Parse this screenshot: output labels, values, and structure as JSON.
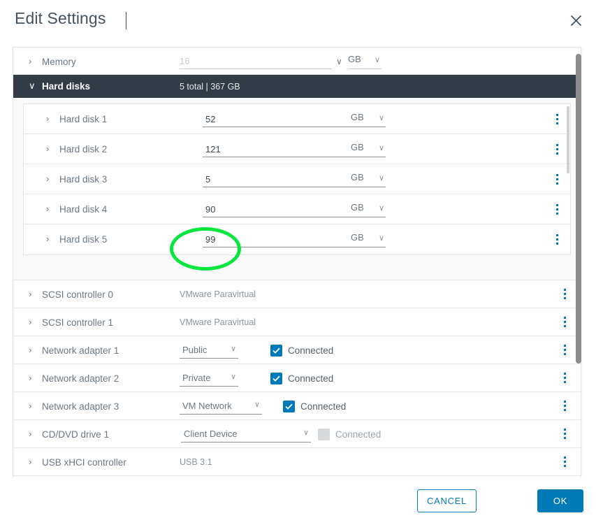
{
  "dialog": {
    "title": "Edit Settings",
    "close_icon": "close-icon"
  },
  "memory": {
    "label": "Memory",
    "caret": "›",
    "value": "",
    "placeholder": "16",
    "unit": "GB",
    "unit_chevron": "∨",
    "spinner_chevron": "∨"
  },
  "hard_disks_group": {
    "label": "Hard disks",
    "caret": "∨",
    "summary": "5 total | 367 GB",
    "disks": [
      {
        "label": "Hard disk 1",
        "caret": "›",
        "value": "52",
        "unit": "GB"
      },
      {
        "label": "Hard disk 2",
        "caret": "›",
        "value": "121",
        "unit": "GB"
      },
      {
        "label": "Hard disk 3",
        "caret": "›",
        "value": "5",
        "unit": "GB"
      },
      {
        "label": "Hard disk 4",
        "caret": "›",
        "value": "90",
        "unit": "GB"
      },
      {
        "label": "Hard disk 5",
        "caret": "›",
        "value": "99",
        "unit": "GB"
      }
    ]
  },
  "devices": [
    {
      "label": "SCSI controller 0",
      "caret": "›",
      "value": "VMware Paravirtual"
    },
    {
      "label": "SCSI controller 1",
      "caret": "›",
      "value": "VMware Paravirtual"
    },
    {
      "label": "Network adapter 1",
      "caret": "›",
      "dropdown": "Public",
      "checkbox_label": "Connected",
      "checked": true
    },
    {
      "label": "Network adapter 2",
      "caret": "›",
      "dropdown": "Private",
      "checkbox_label": "Connected",
      "checked": true
    },
    {
      "label": "Network adapter 3",
      "caret": "›",
      "dropdown": "VM Network",
      "checkbox_label": "Connected",
      "checked": true
    },
    {
      "label": "CD/DVD drive 1",
      "caret": "›",
      "dropdown": "Client Device",
      "checkbox_label": "Connected",
      "checked": false
    },
    {
      "label": "USB xHCI controller",
      "caret": "›",
      "value": "USB 3.1"
    }
  ],
  "footer": {
    "cancel_label": "CANCEL",
    "ok_label": "OK"
  },
  "annotation": {
    "shape": "ellipse",
    "color": "#07e63c",
    "targets": "hard-disk-5-size-input"
  },
  "colors": {
    "accent_blue": "#0079b8",
    "header_dark": "#313c47",
    "label_gray": "#6a7783",
    "annotation_green": "#07e63c"
  }
}
